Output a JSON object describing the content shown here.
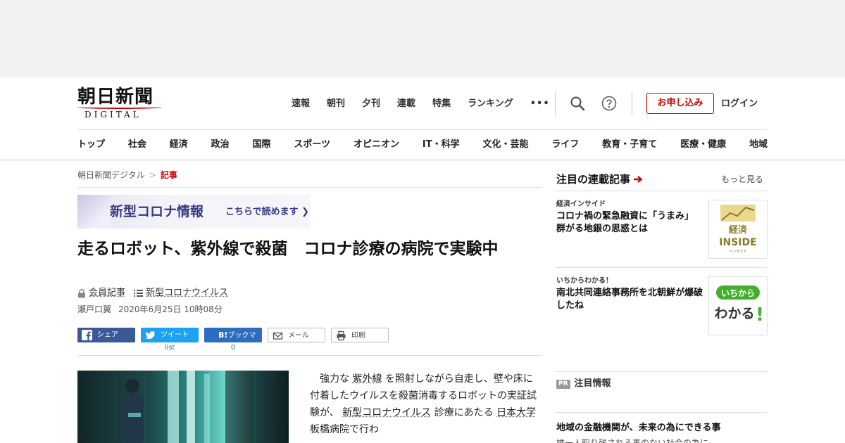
{
  "header": {
    "logo_main": "朝日新聞",
    "logo_sub": "DIGITAL",
    "topnav": [
      "速報",
      "朝刊",
      "夕刊",
      "連載",
      "特集",
      "ランキング",
      "•••"
    ],
    "apply_label": "お申し込み",
    "login_label": "ログイン"
  },
  "catnav": [
    "トップ",
    "社会",
    "経済",
    "政治",
    "国際",
    "スポーツ",
    "オピニオン",
    "IT・科学",
    "文化・芸能",
    "ライフ",
    "教育・子育て",
    "医療・健康",
    "地域"
  ],
  "breadcrumb": {
    "home": "朝日新聞デジタル",
    "sep": ">",
    "current": "記事"
  },
  "banner": {
    "title": "新型コロナ情報",
    "link": "こちらで読めます"
  },
  "article": {
    "headline": "走るロボット、紫外線で殺菌　コロナ診療の病院で実験中",
    "member_label": "会員記事",
    "topic_label": "新型コロナウイルス",
    "author": "瀬戸口翼",
    "date": "2020年6月25日 10時08分",
    "body_parts": [
      {
        "text": "　強力な ",
        "link": false
      },
      {
        "text": "紫外線",
        "link": true
      },
      {
        "text": " を照射しながら自走し、壁や床に付着したウイルスを殺菌消毒するロボットの実証試験が、 ",
        "link": false
      },
      {
        "text": "新型コロナウイルス",
        "link": true
      },
      {
        "text": " 診療にあたる ",
        "link": false
      },
      {
        "text": "日本大学",
        "link": true
      },
      {
        "text": " 板橋病院で行わ",
        "link": false
      }
    ]
  },
  "share": {
    "facebook": "シェア",
    "twitter": "ツイート",
    "twitter_count": "list",
    "hatena_badge": "B!",
    "hatena": "ブックマーク",
    "hatena_count": "0",
    "mail": "メール",
    "print": "印刷"
  },
  "sidebar": {
    "heading": "注目の連載記事",
    "more_label": "もっと見る",
    "items": [
      {
        "kicker": "経済インサイド",
        "title": "コロナ禍の緊急融資に「うまみ」　群がる地銀の思惑とは",
        "thumb_text": "経済",
        "thumb_sub": "INSIDE",
        "thumb_tiny": "インサイド"
      },
      {
        "kicker": "いちからわかる！",
        "title": "南北共同連絡事務所を北朝鮮が爆破したね",
        "thumb_text": "いちから",
        "thumb_sub": "わかる",
        "thumb_mark": "!"
      }
    ],
    "pr_badge": "PR",
    "pr_heading": "注目情報",
    "pr_title": "地域の金融機関が、未来の為にできる事",
    "pr_sub": "誰一人取り残される事のない社会の為に"
  },
  "colors": {
    "accent": "#cc0000",
    "facebook": "#3b5998",
    "twitter": "#1da1f2",
    "hatena": "#2c6ebd"
  }
}
